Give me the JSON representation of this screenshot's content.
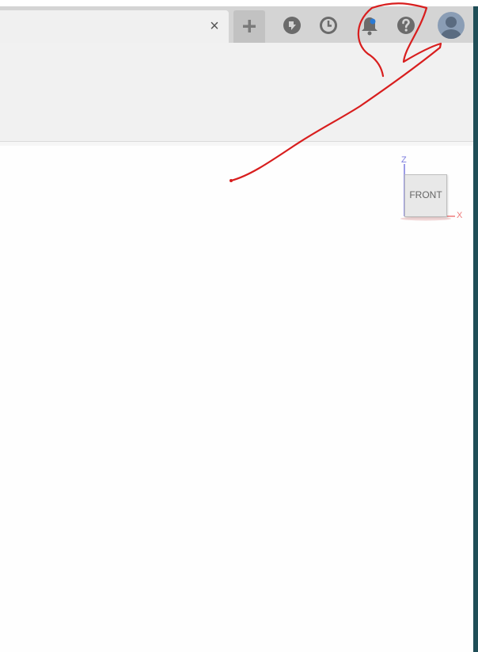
{
  "tabbar": {
    "close_glyph": "×"
  },
  "icons": [
    "plus-icon",
    "plugin-icon",
    "history-clock-icon",
    "notification-bell-icon",
    "help-question-icon",
    "user-avatar-icon"
  ],
  "colors": {
    "tab_bar": "#d4d4d4",
    "notification_dot": "#2a7ad4",
    "annotation_stroke": "#d81e1e",
    "axis_z": "#7b7bde",
    "axis_x": "#ee7b7b"
  },
  "viewcube": {
    "face_label": "FRONT",
    "z_label": "Z",
    "x_label": "X"
  }
}
